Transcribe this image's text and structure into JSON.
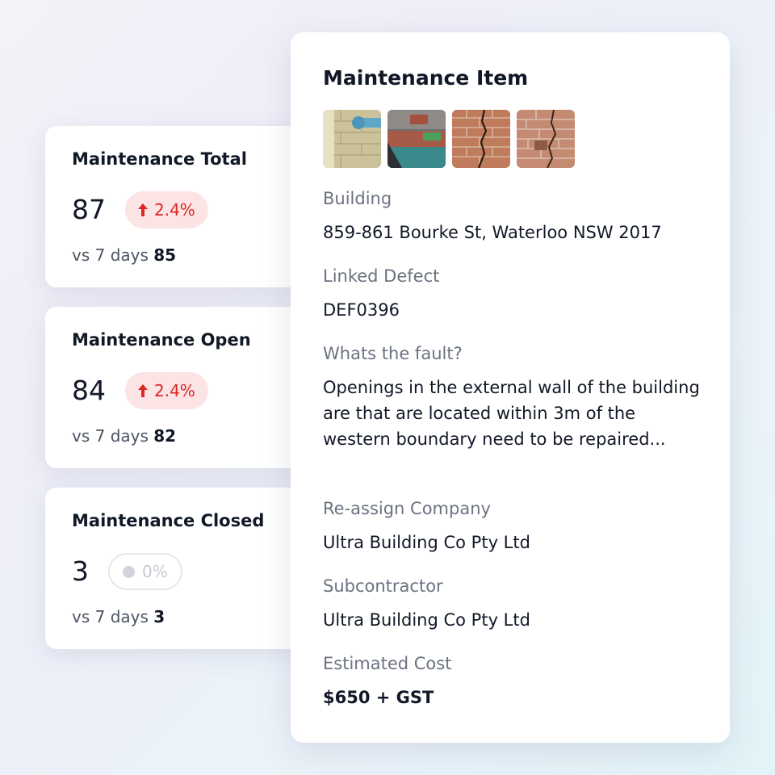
{
  "stats": [
    {
      "title": "Maintenance Total",
      "value": "87",
      "change": "2.4%",
      "trend": "up",
      "compare_label": "vs 7 days",
      "compare_value": "85"
    },
    {
      "title": "Maintenance Open",
      "value": "84",
      "change": "2.4%",
      "trend": "up",
      "compare_label": "vs 7 days",
      "compare_value": "82"
    },
    {
      "title": "Maintenance Closed",
      "value": "3",
      "change": "0%",
      "trend": "neutral",
      "compare_label": "vs 7 days",
      "compare_value": "3"
    }
  ],
  "detail": {
    "title": "Maintenance Item",
    "photos": [
      "Photo 1",
      "Photo 2",
      "Photo 3",
      "Photo 4"
    ],
    "fields": {
      "building": {
        "label": "Building",
        "value": "859-861 Bourke St, Waterloo NSW 2017"
      },
      "linked_defect": {
        "label": "Linked Defect",
        "value": "DEF0396"
      },
      "fault": {
        "label": "Whats the fault?",
        "value": "Openings in the external wall of the building are that are located within 3m of the western boundary need to be repaired..."
      },
      "reassign_company": {
        "label": "Re-assign Company",
        "value": "Ultra Building Co Pty Ltd"
      },
      "subcontractor": {
        "label": "Subcontractor",
        "value": "Ultra Building Co Pty Ltd"
      },
      "estimated_cost": {
        "label": "Estimated Cost",
        "value": "$650 + GST"
      }
    }
  },
  "colors": {
    "up": "#dc2626",
    "up_bg": "#fde4e4",
    "neutral": "#d1d5db"
  }
}
